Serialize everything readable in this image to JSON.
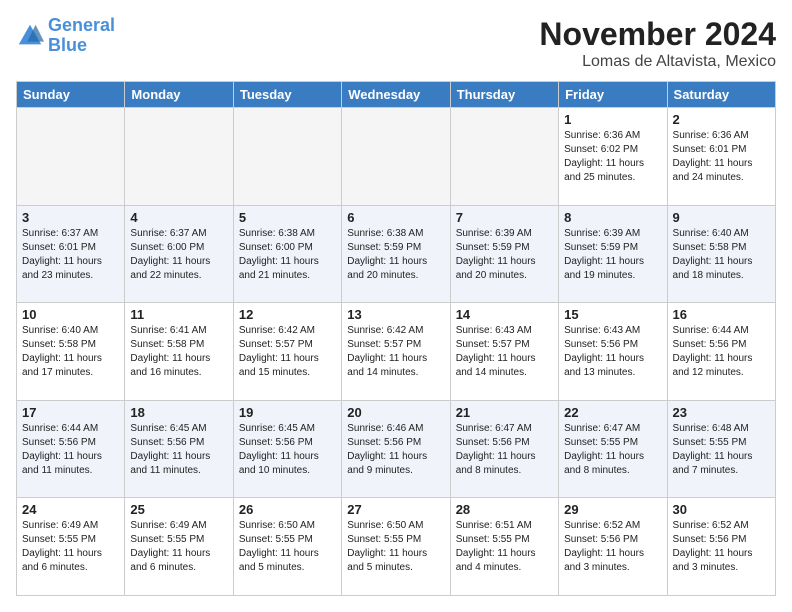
{
  "header": {
    "logo_line1": "General",
    "logo_line2": "Blue",
    "title": "November 2024",
    "subtitle": "Lomas de Altavista, Mexico"
  },
  "days_of_week": [
    "Sunday",
    "Monday",
    "Tuesday",
    "Wednesday",
    "Thursday",
    "Friday",
    "Saturday"
  ],
  "weeks": [
    [
      {
        "day": "",
        "info": ""
      },
      {
        "day": "",
        "info": ""
      },
      {
        "day": "",
        "info": ""
      },
      {
        "day": "",
        "info": ""
      },
      {
        "day": "",
        "info": ""
      },
      {
        "day": "1",
        "info": "Sunrise: 6:36 AM\nSunset: 6:02 PM\nDaylight: 11 hours and 25 minutes."
      },
      {
        "day": "2",
        "info": "Sunrise: 6:36 AM\nSunset: 6:01 PM\nDaylight: 11 hours and 24 minutes."
      }
    ],
    [
      {
        "day": "3",
        "info": "Sunrise: 6:37 AM\nSunset: 6:01 PM\nDaylight: 11 hours and 23 minutes."
      },
      {
        "day": "4",
        "info": "Sunrise: 6:37 AM\nSunset: 6:00 PM\nDaylight: 11 hours and 22 minutes."
      },
      {
        "day": "5",
        "info": "Sunrise: 6:38 AM\nSunset: 6:00 PM\nDaylight: 11 hours and 21 minutes."
      },
      {
        "day": "6",
        "info": "Sunrise: 6:38 AM\nSunset: 5:59 PM\nDaylight: 11 hours and 20 minutes."
      },
      {
        "day": "7",
        "info": "Sunrise: 6:39 AM\nSunset: 5:59 PM\nDaylight: 11 hours and 20 minutes."
      },
      {
        "day": "8",
        "info": "Sunrise: 6:39 AM\nSunset: 5:59 PM\nDaylight: 11 hours and 19 minutes."
      },
      {
        "day": "9",
        "info": "Sunrise: 6:40 AM\nSunset: 5:58 PM\nDaylight: 11 hours and 18 minutes."
      }
    ],
    [
      {
        "day": "10",
        "info": "Sunrise: 6:40 AM\nSunset: 5:58 PM\nDaylight: 11 hours and 17 minutes."
      },
      {
        "day": "11",
        "info": "Sunrise: 6:41 AM\nSunset: 5:58 PM\nDaylight: 11 hours and 16 minutes."
      },
      {
        "day": "12",
        "info": "Sunrise: 6:42 AM\nSunset: 5:57 PM\nDaylight: 11 hours and 15 minutes."
      },
      {
        "day": "13",
        "info": "Sunrise: 6:42 AM\nSunset: 5:57 PM\nDaylight: 11 hours and 14 minutes."
      },
      {
        "day": "14",
        "info": "Sunrise: 6:43 AM\nSunset: 5:57 PM\nDaylight: 11 hours and 14 minutes."
      },
      {
        "day": "15",
        "info": "Sunrise: 6:43 AM\nSunset: 5:56 PM\nDaylight: 11 hours and 13 minutes."
      },
      {
        "day": "16",
        "info": "Sunrise: 6:44 AM\nSunset: 5:56 PM\nDaylight: 11 hours and 12 minutes."
      }
    ],
    [
      {
        "day": "17",
        "info": "Sunrise: 6:44 AM\nSunset: 5:56 PM\nDaylight: 11 hours and 11 minutes."
      },
      {
        "day": "18",
        "info": "Sunrise: 6:45 AM\nSunset: 5:56 PM\nDaylight: 11 hours and 11 minutes."
      },
      {
        "day": "19",
        "info": "Sunrise: 6:45 AM\nSunset: 5:56 PM\nDaylight: 11 hours and 10 minutes."
      },
      {
        "day": "20",
        "info": "Sunrise: 6:46 AM\nSunset: 5:56 PM\nDaylight: 11 hours and 9 minutes."
      },
      {
        "day": "21",
        "info": "Sunrise: 6:47 AM\nSunset: 5:56 PM\nDaylight: 11 hours and 8 minutes."
      },
      {
        "day": "22",
        "info": "Sunrise: 6:47 AM\nSunset: 5:55 PM\nDaylight: 11 hours and 8 minutes."
      },
      {
        "day": "23",
        "info": "Sunrise: 6:48 AM\nSunset: 5:55 PM\nDaylight: 11 hours and 7 minutes."
      }
    ],
    [
      {
        "day": "24",
        "info": "Sunrise: 6:49 AM\nSunset: 5:55 PM\nDaylight: 11 hours and 6 minutes."
      },
      {
        "day": "25",
        "info": "Sunrise: 6:49 AM\nSunset: 5:55 PM\nDaylight: 11 hours and 6 minutes."
      },
      {
        "day": "26",
        "info": "Sunrise: 6:50 AM\nSunset: 5:55 PM\nDaylight: 11 hours and 5 minutes."
      },
      {
        "day": "27",
        "info": "Sunrise: 6:50 AM\nSunset: 5:55 PM\nDaylight: 11 hours and 5 minutes."
      },
      {
        "day": "28",
        "info": "Sunrise: 6:51 AM\nSunset: 5:55 PM\nDaylight: 11 hours and 4 minutes."
      },
      {
        "day": "29",
        "info": "Sunrise: 6:52 AM\nSunset: 5:56 PM\nDaylight: 11 hours and 3 minutes."
      },
      {
        "day": "30",
        "info": "Sunrise: 6:52 AM\nSunset: 5:56 PM\nDaylight: 11 hours and 3 minutes."
      }
    ]
  ]
}
